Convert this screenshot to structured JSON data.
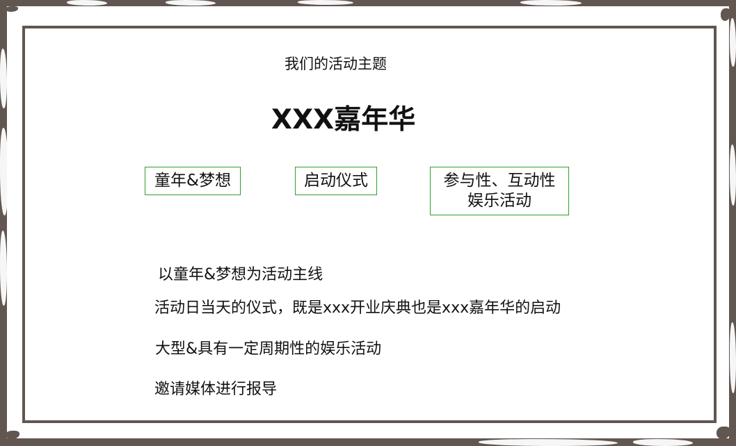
{
  "slide": {
    "subtitle": "我们的活动主题",
    "title": "XXX嘉年华",
    "themes": [
      "童年&梦想",
      "启动仪式",
      "参与性、互动性\n娱乐活动"
    ],
    "details": [
      "以童年&梦想为活动主线",
      "活动日当天的仪式，既是xxx开业庆典也是xxx嘉年华的启动",
      "大型&具有一定周期性的娱乐活动",
      "邀请媒体进行报导"
    ]
  },
  "colors": {
    "frame": "#625650",
    "box_border": "#2f9f2f",
    "text": "#111111",
    "background": "#ffffff"
  }
}
